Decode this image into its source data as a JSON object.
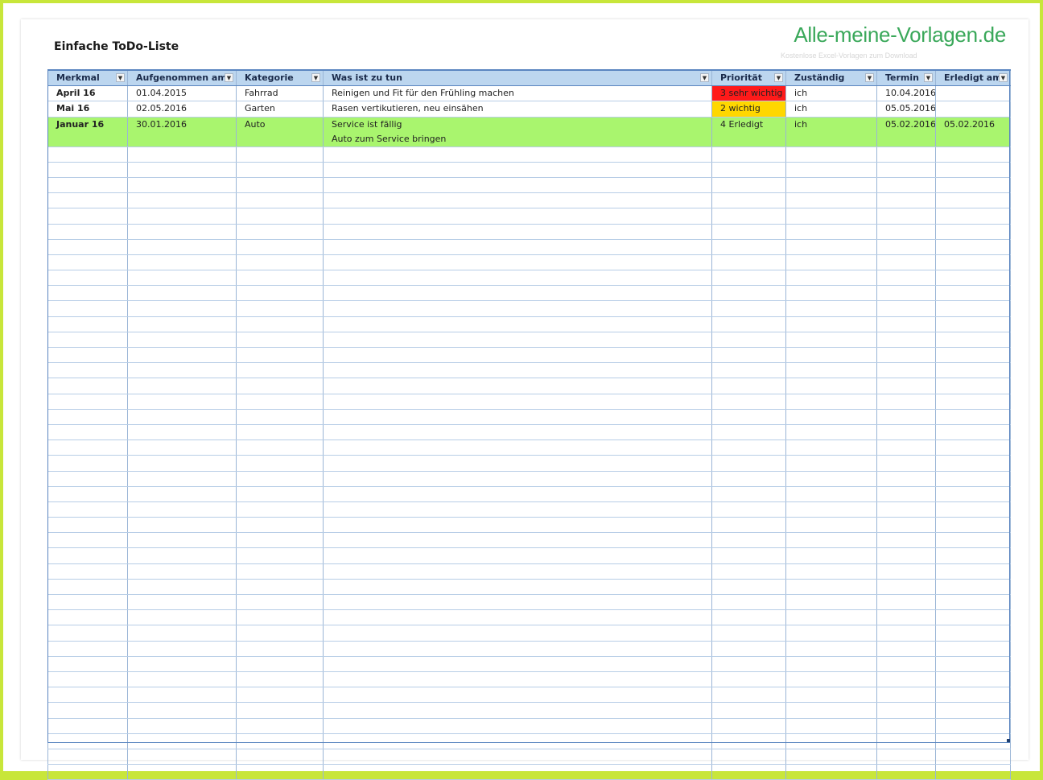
{
  "sheet": {
    "title": "Einfache ToDo-Liste",
    "brand": "Alle-meine-Vorlagen.de",
    "brand_sub": "Kostenlose Excel-Vorlagen zum Download"
  },
  "columns": [
    {
      "label": "Merkmal",
      "filter_icon": "dropdown-arrow-icon"
    },
    {
      "label": "Aufgenommen am",
      "filter_icon": "dropdown-arrow-icon"
    },
    {
      "label": "Kategorie",
      "filter_icon": "dropdown-arrow-icon"
    },
    {
      "label": "Was ist zu tun",
      "filter_icon": "dropdown-arrow-icon"
    },
    {
      "label": "Priorität",
      "filter_icon": "dropdown-arrow-icon"
    },
    {
      "label": "Zuständig",
      "filter_icon": "dropdown-arrow-icon"
    },
    {
      "label": "Termin",
      "filter_icon": "dropdown-arrow-icon"
    },
    {
      "label": "Erledigt am",
      "filter_icon": "dropdown-arrow-icon"
    }
  ],
  "rows": [
    {
      "merkmal": "April 16",
      "aufgenommen": "01.04.2015",
      "kategorie": "Fahrrad",
      "task": "Reinigen und Fit für den Frühling machen",
      "task2": "",
      "prioritaet": "3 sehr wichtig",
      "prio_color": "#ff1a1a",
      "zustaendig": "ich",
      "termin": "10.04.2016",
      "erledigt": ""
    },
    {
      "merkmal": "Mai 16",
      "aufgenommen": "02.05.2016",
      "kategorie": "Garten",
      "task": "Rasen vertikutieren, neu einsähen",
      "task2": "",
      "prioritaet": "2 wichtig",
      "prio_color": "#ffd700",
      "zustaendig": "ich",
      "termin": "05.05.2016",
      "erledigt": ""
    },
    {
      "merkmal": "Januar 16",
      "aufgenommen": "30.01.2016",
      "kategorie": "Auto",
      "task": "Service ist fällig",
      "task2": "Auto zum Service bringen",
      "prioritaet": "4 Erledigt",
      "prio_color": "#a9f56e",
      "zustaendig": "ich",
      "termin": "05.02.2016",
      "erledigt": "05.02.2016"
    }
  ],
  "colors": {
    "header_bg": "#bcd6ef",
    "done_row": "#a9f56e",
    "brand": "#3aa85a",
    "background": "#c8e63a"
  }
}
